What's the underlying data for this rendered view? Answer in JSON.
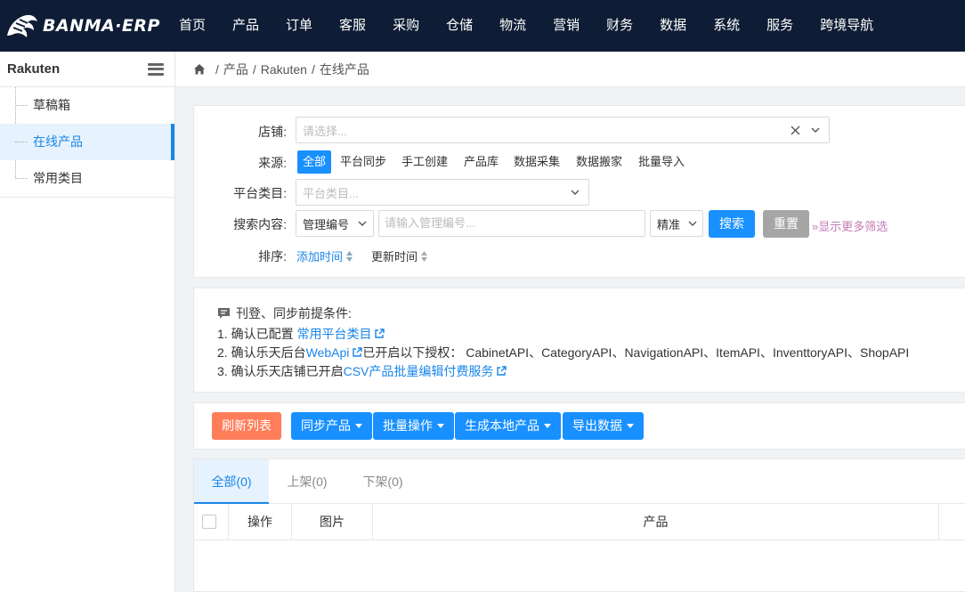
{
  "app": {
    "logo_text": "BANMA·ERP"
  },
  "nav": [
    "首页",
    "产品",
    "订单",
    "客服",
    "采购",
    "仓储",
    "物流",
    "营销",
    "财务",
    "数据",
    "系统",
    "服务",
    "跨境导航"
  ],
  "sidebar": {
    "title": "Rakuten",
    "items": [
      {
        "label": "草稿箱"
      },
      {
        "label": "在线产品"
      },
      {
        "label": "常用类目"
      }
    ]
  },
  "breadcrumb": [
    "产品",
    "Rakuten",
    "在线产品"
  ],
  "filter": {
    "shop_label": "店铺:",
    "shop_placeholder": "请选择...",
    "source_label": "来源:",
    "sources": [
      "全部",
      "平台同步",
      "手工创建",
      "产品库",
      "数据采集",
      "数据搬家",
      "批量导入"
    ],
    "category_label": "平台类目:",
    "category_placeholder": "平台类目...",
    "search_label": "搜索内容:",
    "search_field": "管理编号",
    "search_placeholder": "请输入管理编号...",
    "match_mode": "精准",
    "search_button": "搜索",
    "reset_button": "重置",
    "more_filters": "显示更多筛选",
    "sort_label": "排序:",
    "sort_added": "添加时间",
    "sort_updated": "更新时间"
  },
  "notice": {
    "title": "刊登、同步前提条件:",
    "l1_prefix": "1. 确认已配置",
    "l1_link": "常用平台类目",
    "l2_prefix": "2. 确认乐天后台",
    "l2_link": "WebApi",
    "l2_suffix": "已开启以下授权：",
    "l2_apis": "CabinetAPI、CategoryAPI、NavigationAPI、ItemAPI、InventtoryAPI、ShopAPI",
    "l3_prefix": "3. 确认乐天店铺已开启",
    "l3_link": "CSV产品批量编辑付费服务"
  },
  "toolbar": {
    "refresh": "刷新列表",
    "sync": "同步产品",
    "batch": "批量操作",
    "generate": "生成本地产品",
    "export": "导出数据"
  },
  "tabs": [
    "全部(0)",
    "上架(0)",
    "下架(0)"
  ],
  "table": {
    "columns": [
      "操作",
      "图片",
      "产品"
    ]
  },
  "colors": {
    "nav_bg": "#0e1d35",
    "primary": "#1890ff",
    "orange": "#ff7d59",
    "gray": "#a6a6a6",
    "accent_link": "#c57ab4"
  }
}
